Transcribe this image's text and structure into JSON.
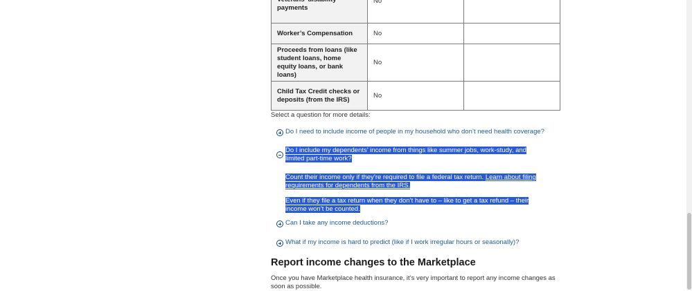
{
  "table": {
    "rows": [
      {
        "label": "Veterans’ disability payments",
        "value": "No"
      },
      {
        "label": "Worker’s Compensation",
        "value": "No"
      },
      {
        "label": "Proceeds from loans (like student loans, home equity loans, or bank loans)",
        "value": "No"
      },
      {
        "label": "Child Tax Credit checks or deposits (from the IRS)",
        "value": "No"
      }
    ]
  },
  "select_note": "Select a question for more details:",
  "accordion": {
    "q1": "Do I need to include income of people in my household who don’t need health coverage?",
    "q2": "Do I include my dependents’ income from things like summer jobs, work-study, and limited part-time work?",
    "a1_text": "Count their income only if they’re required to file a federal tax return.",
    "a1_link": "Learn about filing requirements for dependents from the IRS.",
    "a2_text": "Even if they file a tax return when they don’t have to – like to get a tax refund – their income won’t be counted.",
    "q3": "Can I take any income deductions?",
    "q4": "What if my income is hard to predict (like if I work irregular hours or seasonally)?"
  },
  "section": {
    "title": "Report income changes to the Marketplace",
    "text": "Once you have Marketplace health insurance, it’s very important to report any income changes as soon as possible."
  },
  "colors": {
    "link": "#1f5c8e",
    "selection": "#2a5bd7",
    "table_header_bg": "#f2f2f2"
  }
}
